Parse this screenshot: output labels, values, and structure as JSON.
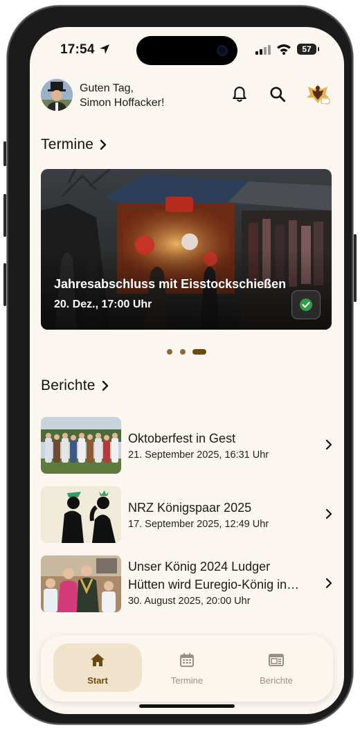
{
  "status_bar": {
    "time": "17:54",
    "battery": "57"
  },
  "header": {
    "greeting_line1": "Guten Tag,",
    "greeting_line2": "Simon Hoffacker!"
  },
  "termine": {
    "title": "Termine",
    "card": {
      "title": "Jahresabschluss mit Eisstockschießen",
      "date": "20. Dez., 17:00 Uhr",
      "status": "confirmed"
    },
    "carousel": {
      "count": 3,
      "active_index": 2
    }
  },
  "berichte": {
    "title": "Berichte",
    "items": [
      {
        "title": "Oktoberfest in Gest",
        "date": "21. September 2025, 16:31 Uhr"
      },
      {
        "title": "NRZ Königspaar 2025",
        "date": "17. September 2025, 12:49 Uhr"
      },
      {
        "title_line1": "Unser König 2024 Ludger",
        "title_line2": "Hütten wird Euregio-König in…",
        "date": "30. August 2025, 20:00 Uhr"
      }
    ]
  },
  "bottom_nav": {
    "items": [
      {
        "label": "Start",
        "icon": "home-icon",
        "active": true
      },
      {
        "label": "Termine",
        "icon": "calendar-icon",
        "active": false
      },
      {
        "label": "Berichte",
        "icon": "newspaper-icon",
        "active": false
      }
    ]
  },
  "colors": {
    "accent": "#6a4a10",
    "background": "#fbf6f0",
    "nav_active_bg": "#f1e2cc",
    "inactive": "#9a8f84",
    "check_green": "#2f9e44"
  }
}
